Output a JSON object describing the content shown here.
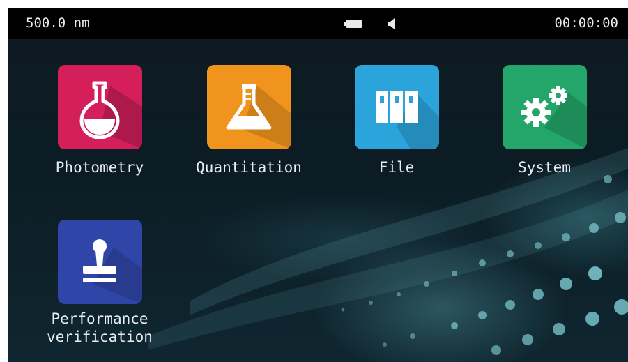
{
  "status_bar": {
    "wavelength": "500.0 nm",
    "battery_icon": "battery-icon",
    "speaker_icon": "speaker-icon",
    "clock": "00:00:00"
  },
  "apps": [
    {
      "label": "Photometry",
      "icon": "flask-icon",
      "color": "#d41f5b"
    },
    {
      "label": "Quantitation",
      "icon": "beaker-icon",
      "color": "#f0941e"
    },
    {
      "label": "File",
      "icon": "binders-icon",
      "color": "#2ba4dc"
    },
    {
      "label": "System",
      "icon": "gears-icon",
      "color": "#24a569"
    },
    {
      "label_line1": "Performance",
      "label_line2": "verification",
      "icon": "stamp-icon",
      "color": "#2f46a8"
    }
  ]
}
